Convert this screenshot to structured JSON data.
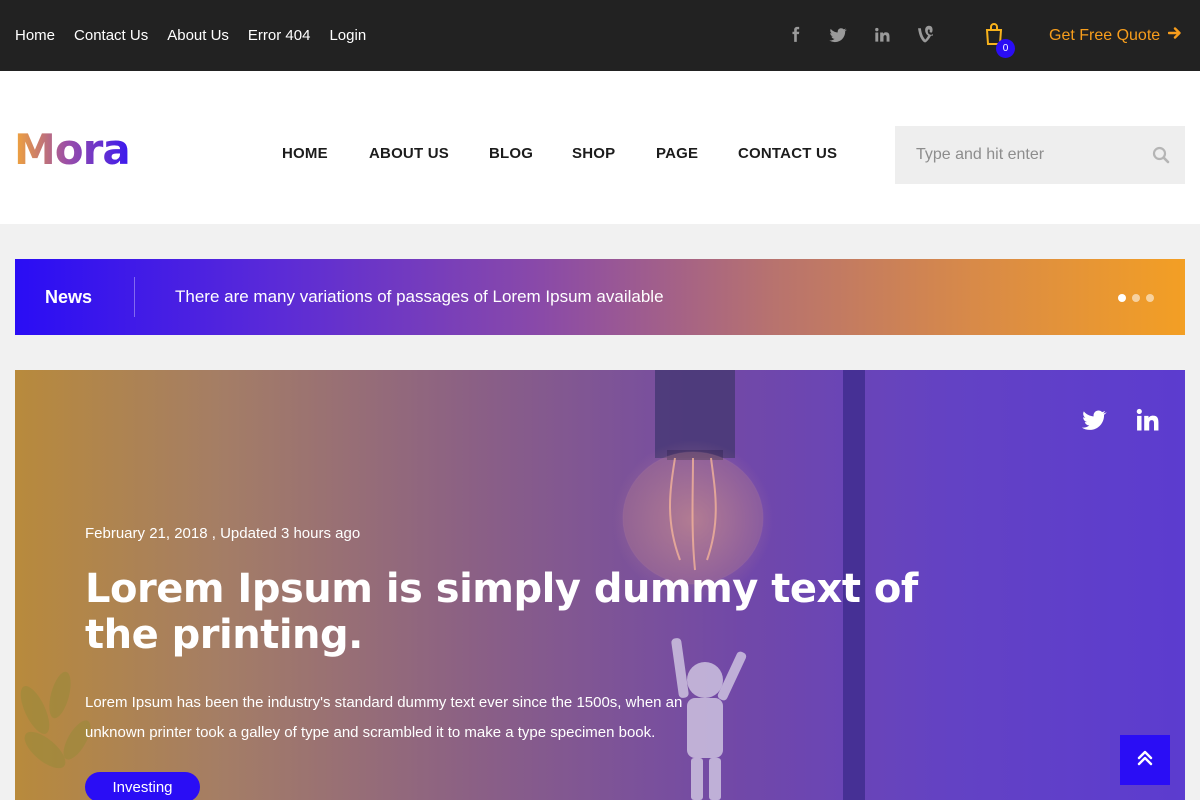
{
  "topbar": {
    "links": [
      "Home",
      "Contact Us",
      "About Us",
      "Error 404",
      "Login"
    ],
    "social_icons": [
      "facebook-icon",
      "twitter-icon",
      "linkedin-icon",
      "vine-icon"
    ],
    "cart_count": "0",
    "quote_label": "Get Free Quote"
  },
  "header": {
    "logo_text": "Mora",
    "nav": [
      "HOME",
      "ABOUT US",
      "BLOG",
      "SHOP",
      "PAGE",
      "CONTACT US"
    ],
    "search": {
      "placeholder": "Type and hit enter"
    }
  },
  "ticker": {
    "label": "News",
    "text": "There are many variations of passages of Lorem Ipsum available",
    "slides_total": 3,
    "active_slide": 1
  },
  "hero": {
    "share_icons": [
      "twitter-icon",
      "linkedin-icon"
    ],
    "date": "February 21, 2018 , Updated 3 hours ago",
    "title": "Lorem Ipsum is simply dummy text of the printing.",
    "description": "Lorem Ipsum has been the industry's standard dummy text ever since the 1500s, when an unknown printer took a galley of type and scrambled it to make a type specimen book.",
    "tag": "Investing"
  },
  "colors": {
    "accent_blue": "#2a0df5",
    "accent_orange": "#f79d1c",
    "topbar_bg": "#222222"
  }
}
